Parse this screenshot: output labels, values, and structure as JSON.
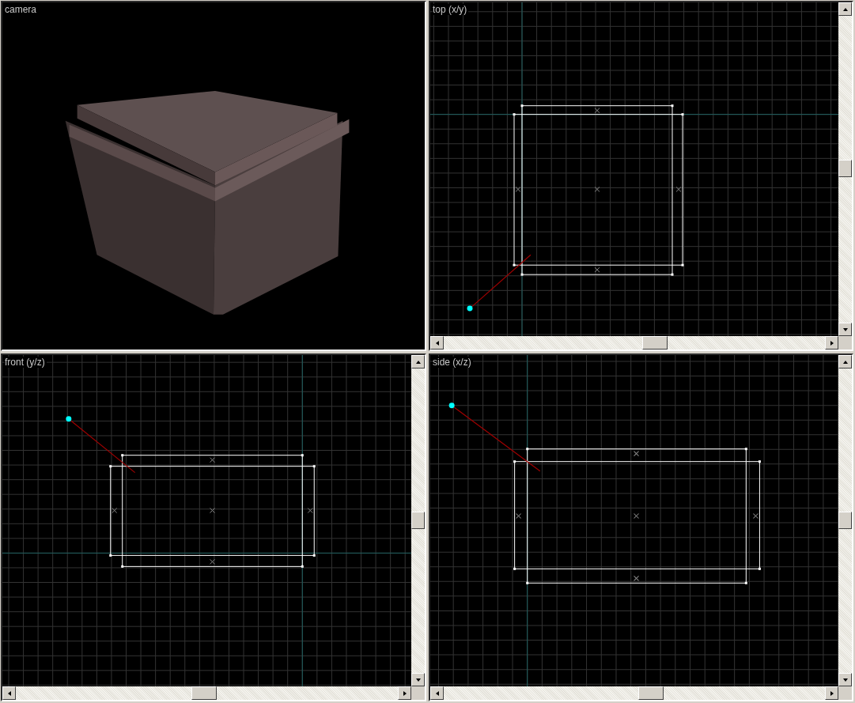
{
  "viewports": [
    {
      "kind": "camera",
      "label": "camera"
    },
    {
      "kind": "ortho",
      "label": "top (x/y)"
    },
    {
      "kind": "ortho",
      "label": "front (y/z)"
    },
    {
      "kind": "ortho",
      "label": "side (x/z)"
    }
  ]
}
